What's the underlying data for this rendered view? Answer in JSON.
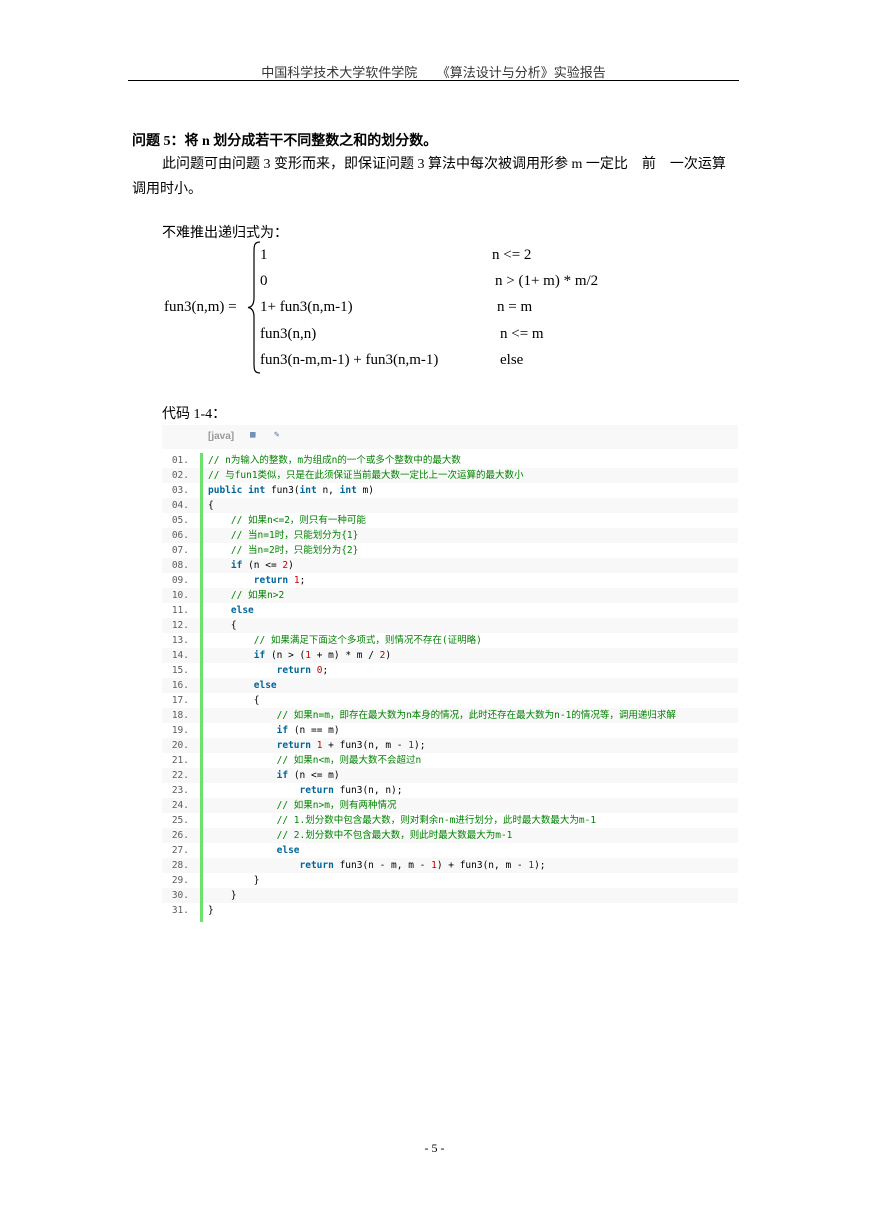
{
  "header": {
    "text": "中国科学技术大学软件学院　　《算法设计与分析》实验报告"
  },
  "heading": "问题 5：将 n 划分成若干不同整数之和的划分数。",
  "paragraph": "此问题可由问题 3 变形而来，即保证问题 3 算法中每次被调用形参 m 一定比　前　一次运算调用时小。",
  "lead": "不难推出递归式为：",
  "formula": {
    "lhs": "fun3(n,m) =",
    "cases": [
      {
        "value": "1",
        "cond": "n <= 2"
      },
      {
        "value": "0",
        "cond": "n > (1+ m) * m/2"
      },
      {
        "value": "1+ fun3(n,m-1)",
        "cond": "n = m"
      },
      {
        "value": "fun3(n,n)",
        "cond": "n <= m"
      },
      {
        "value": "fun3(n-m,m-1) + fun3(n,m-1)",
        "cond": "else"
      }
    ]
  },
  "code_label": "代码 1-4：",
  "code": {
    "lang_label": "[java]",
    "icons": [
      "view-source-icon",
      "copy-icon"
    ],
    "lines": [
      {
        "n": "01.",
        "text": "// n为输入的整数，m为组成n的一个或多个整数中的最大数",
        "type": "comment"
      },
      {
        "n": "02.",
        "text": "// 与fun1类似，只是在此须保证当前最大数一定比上一次运算的最大数小",
        "type": "comment"
      },
      {
        "n": "03.",
        "text": "public int fun3(int n, int m)",
        "type": "code"
      },
      {
        "n": "04.",
        "text": "{",
        "type": "code"
      },
      {
        "n": "05.",
        "text": "    // 如果n<=2，则只有一种可能",
        "type": "comment"
      },
      {
        "n": "06.",
        "text": "    // 当n=1时，只能划分为{1}",
        "type": "comment"
      },
      {
        "n": "07.",
        "text": "    // 当n=2时，只能划分为{2}",
        "type": "comment"
      },
      {
        "n": "08.",
        "text": "    if (n <= 2)",
        "type": "code"
      },
      {
        "n": "09.",
        "text": "        return 1;",
        "type": "code"
      },
      {
        "n": "10.",
        "text": "    // 如果n>2",
        "type": "comment"
      },
      {
        "n": "11.",
        "text": "    else",
        "type": "code"
      },
      {
        "n": "12.",
        "text": "    {",
        "type": "code"
      },
      {
        "n": "13.",
        "text": "        // 如果满足下面这个多项式，则情况不存在(证明略)",
        "type": "comment"
      },
      {
        "n": "14.",
        "text": "        if (n > (1 + m) * m / 2)",
        "type": "code"
      },
      {
        "n": "15.",
        "text": "            return 0;",
        "type": "code"
      },
      {
        "n": "16.",
        "text": "        else",
        "type": "code"
      },
      {
        "n": "17.",
        "text": "        {",
        "type": "code"
      },
      {
        "n": "18.",
        "text": "            // 如果n=m，即存在最大数为n本身的情况，此时还存在最大数为n-1的情况等，调用递归求解",
        "type": "comment"
      },
      {
        "n": "19.",
        "text": "            if (n == m)",
        "type": "code"
      },
      {
        "n": "20.",
        "text": "            return 1 + fun3(n, m - 1);",
        "type": "code"
      },
      {
        "n": "21.",
        "text": "            // 如果n<m，则最大数不会超过n",
        "type": "comment"
      },
      {
        "n": "22.",
        "text": "            if (n <= m)",
        "type": "code"
      },
      {
        "n": "23.",
        "text": "                return fun3(n, n);",
        "type": "code"
      },
      {
        "n": "24.",
        "text": "            // 如果n>m，则有两种情况",
        "type": "comment"
      },
      {
        "n": "25.",
        "text": "            // 1.划分数中包含最大数，则对剩余n-m进行划分，此时最大数最大为m-1",
        "type": "comment"
      },
      {
        "n": "26.",
        "text": "            // 2.划分数中不包含最大数，则此时最大数最大为m-1",
        "type": "comment"
      },
      {
        "n": "27.",
        "text": "            else",
        "type": "code"
      },
      {
        "n": "28.",
        "text": "                return fun3(n - m, m - 1) + fun3(n, m - 1);",
        "type": "code"
      },
      {
        "n": "29.",
        "text": "        }",
        "type": "code"
      },
      {
        "n": "30.",
        "text": "    }",
        "type": "code"
      },
      {
        "n": "31.",
        "text": "}",
        "type": "code"
      }
    ]
  },
  "footer": "- 5 -"
}
